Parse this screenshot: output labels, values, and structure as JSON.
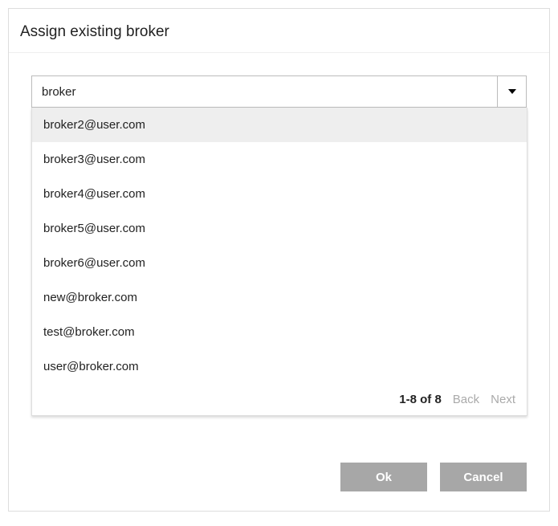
{
  "dialog": {
    "title": "Assign existing broker"
  },
  "combo": {
    "value": "broker"
  },
  "dropdown": {
    "items": [
      "broker2@user.com",
      "broker3@user.com",
      "broker4@user.com",
      "broker5@user.com",
      "broker6@user.com",
      "new@broker.com",
      "test@broker.com",
      "user@broker.com"
    ],
    "pageInfo": "1-8 of 8",
    "backLabel": "Back",
    "nextLabel": "Next"
  },
  "buttons": {
    "ok": "Ok",
    "cancel": "Cancel"
  }
}
